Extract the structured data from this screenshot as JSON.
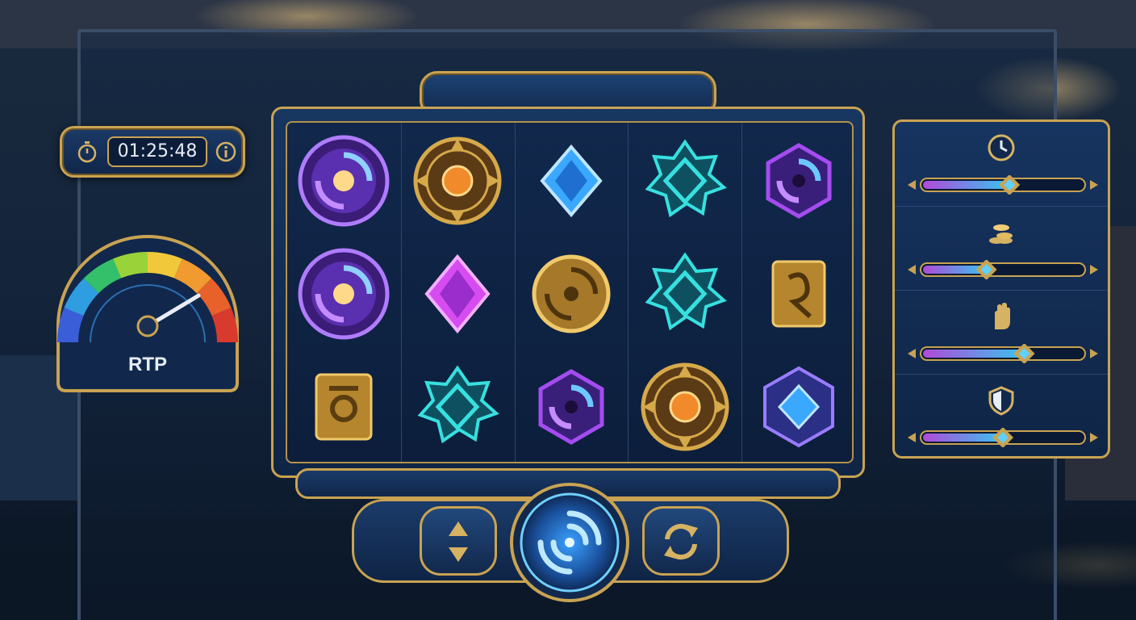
{
  "timer": {
    "time": "01:25:48"
  },
  "gauge": {
    "label": "RTP",
    "needle_fraction": 0.8
  },
  "reels": [
    [
      "galaxy-swirl-orb",
      "galaxy-swirl-orb",
      "gold-rune-tile"
    ],
    [
      "gold-compass-amulet",
      "purple-diamond-gem",
      "teal-octagram-star"
    ],
    [
      "blue-diamond-gem",
      "gold-vortex-coin",
      "purple-hex-vortex"
    ],
    [
      "teal-octagram-star",
      "teal-octagram-star",
      "gold-compass-amulet"
    ],
    [
      "purple-hex-vortex",
      "gold-glyph-tile",
      "blue-crystal-hex"
    ]
  ],
  "controls": {
    "bet_icon": "up-down-arrows-icon",
    "spin_icon": "swirl-spin-icon",
    "autoplay_icon": "refresh-icon"
  },
  "settings": [
    {
      "icon": "clock-icon",
      "level": 0.54
    },
    {
      "icon": "coins-icon",
      "level": 0.4
    },
    {
      "icon": "hand-icon",
      "level": 0.63
    },
    {
      "icon": "shield-icon",
      "level": 0.5
    }
  ],
  "colors": {
    "gold": "#c9a352",
    "navy": "#12294d",
    "slider_start": "#b04ad9",
    "slider_end": "#38c4f0"
  }
}
